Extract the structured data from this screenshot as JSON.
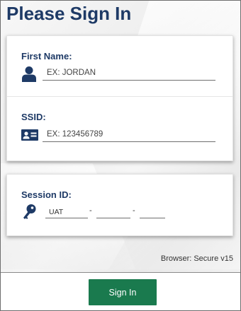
{
  "page": {
    "title": "Please Sign In"
  },
  "colors": {
    "title": "#1e3a66",
    "button": "#1a7a4e",
    "button_text": "#ffffff"
  },
  "first_name": {
    "label": "First Name:",
    "placeholder": "EX: JORDAN",
    "value": "",
    "icon": "person-icon"
  },
  "ssid": {
    "label": "SSID:",
    "placeholder": "EX: 123456789",
    "value": "",
    "icon": "id-card-icon"
  },
  "session": {
    "label": "Session ID:",
    "icon": "key-icon",
    "segments": [
      {
        "value": "UAT"
      },
      {
        "value": ""
      },
      {
        "value": ""
      }
    ],
    "separator": "-"
  },
  "browser_info": "Browser: Secure v15",
  "footer": {
    "signin_label": "Sign In"
  }
}
